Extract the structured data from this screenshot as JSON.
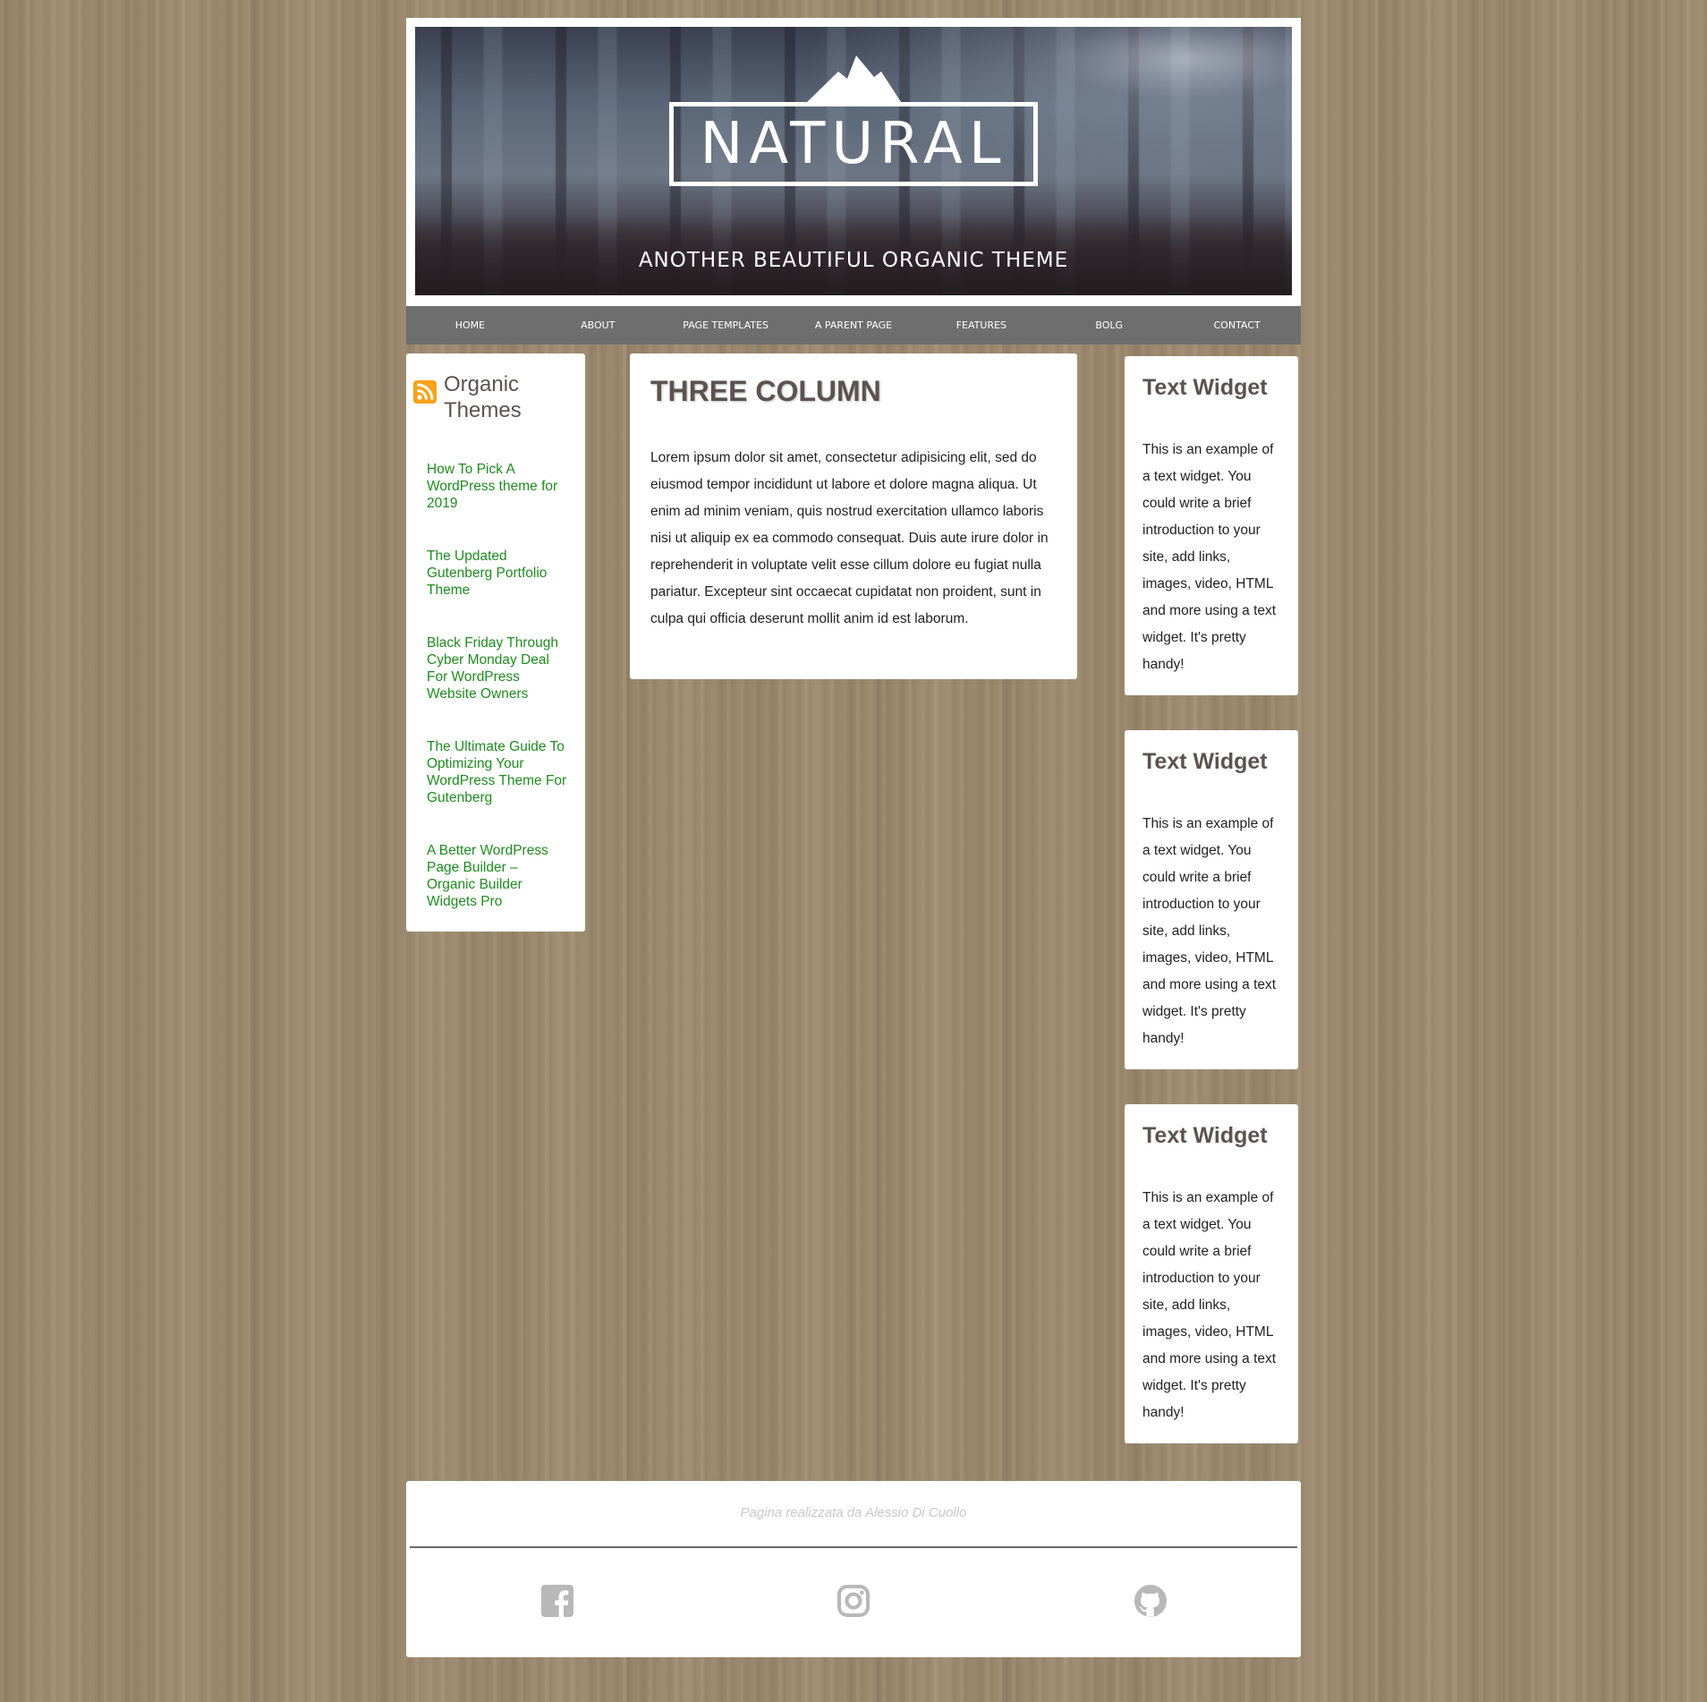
{
  "header": {
    "logo_text": "NATURAL",
    "tagline": "ANOTHER BEAUTIFUL ORGANIC THEME"
  },
  "nav": {
    "items": [
      "HOME",
      "ABOUT",
      "PAGE TEMPLATES",
      "A PARENT PAGE",
      "FEATURES",
      "BOLG",
      "CONTACT"
    ]
  },
  "left_sidebar": {
    "icon": "rss-icon",
    "title": "Organic Themes",
    "links": [
      "How To Pick A WordPress theme for 2019",
      "The Updated Gutenberg Portfolio Theme",
      "Black Friday Through Cyber Monday Deal For WordPress Website Owners",
      "The Ultimate Guide To Optimizing Your WordPress Theme For Gutenberg",
      "A Better WordPress Page Builder – Organic Builder Widgets Pro"
    ],
    "link_color": "#1f8b1f"
  },
  "main": {
    "title": "THREE COLUMN",
    "body": "Lorem ipsum dolor sit amet, consectetur adipisicing elit, sed do eiusmod tempor incididunt ut labore et dolore magna aliqua. Ut enim ad minim veniam, quis nostrud exercitation ullamco laboris nisi ut aliquip ex ea commodo consequat. Duis aute irure dolor in reprehenderit in voluptate velit esse cillum dolore eu fugiat nulla pariatur. Excepteur sint occaecat cupidatat non proident, sunt in culpa qui officia deserunt mollit anim id est laborum."
  },
  "widgets": [
    {
      "title": "Text Widget",
      "body": "This is an example of a text widget. You could write a brief introduction to your site, add links, images, video, HTML and more using a text widget. It's pretty handy!"
    },
    {
      "title": "Text Widget",
      "body": "This is an example of a text widget. You could write a brief introduction to your site, add links, images, video, HTML and more using a text widget. It's pretty handy!"
    },
    {
      "title": "Text Widget",
      "body": "This is an example of a text widget. You could write a brief introduction to your site, add links, images, video, HTML and more using a text widget. It's pretty handy!"
    }
  ],
  "footer": {
    "credit": "Pagina realizzata da Alessio Di Cuollo",
    "social_icons": [
      "facebook-icon",
      "instagram-icon",
      "github-icon"
    ]
  },
  "colors": {
    "background": "#9c8a6e",
    "nav_background": "#6e6e6e",
    "heading_text": "#5c5350",
    "footer_credit": "#c8c8c8"
  }
}
